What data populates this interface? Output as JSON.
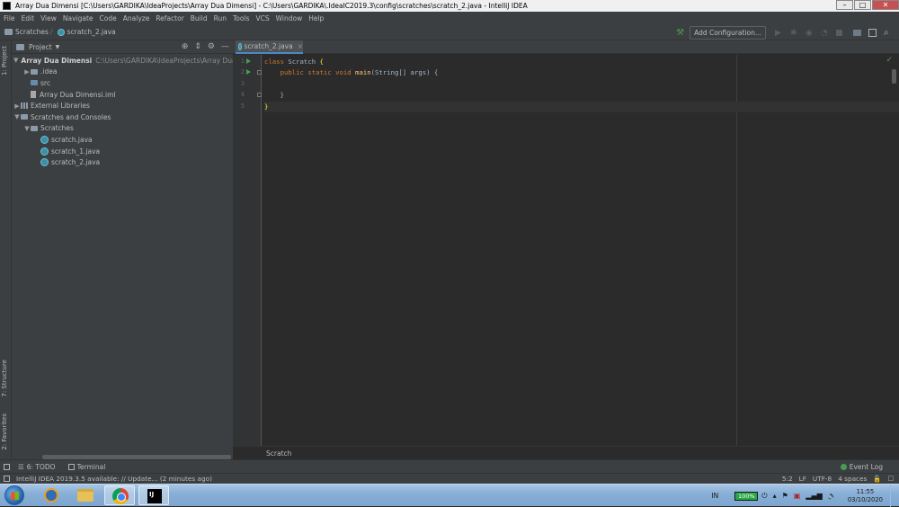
{
  "window": {
    "title": "Array Dua Dimensi [C:\\Users\\GARDIKA\\IdeaProjects\\Array Dua Dimensi] - C:\\Users\\GARDIKA\\.IdeaIC2019.3\\config\\scratches\\scratch_2.java - IntelliJ IDEA",
    "controls": [
      "–",
      "□",
      "✕"
    ]
  },
  "menu": [
    "File",
    "Edit",
    "View",
    "Navigate",
    "Code",
    "Analyze",
    "Refactor",
    "Build",
    "Run",
    "Tools",
    "VCS",
    "Window",
    "Help"
  ],
  "navbar": {
    "crumbs": [
      "Scratches",
      "scratch_2.java"
    ],
    "add_config": "Add Configuration..."
  },
  "left_strip": {
    "project_tab": "1: Project",
    "structure_tab": "7: Structure",
    "favorites_tab": "2: Favorites"
  },
  "project_panel": {
    "header": "Project",
    "tree": [
      {
        "label": "Array Dua Dimensi",
        "path": "C:\\Users\\GARDIKA\\IdeaProjects\\Array Dua Dimensi",
        "indent": 0,
        "arrow": "▼",
        "icon": "folder",
        "bold": true
      },
      {
        "label": ".idea",
        "indent": 1,
        "arrow": "▶",
        "icon": "folder"
      },
      {
        "label": "src",
        "indent": 1,
        "arrow": "",
        "icon": "src"
      },
      {
        "label": "Array Dua Dimensi.iml",
        "indent": 1,
        "arrow": "",
        "icon": "iml"
      },
      {
        "label": "External Libraries",
        "indent": 0,
        "arrow": "▶",
        "icon": "lib"
      },
      {
        "label": "Scratches and Consoles",
        "indent": 0,
        "arrow": "▼",
        "icon": "folder"
      },
      {
        "label": "Scratches",
        "indent": 1,
        "arrow": "▼",
        "icon": "folder"
      },
      {
        "label": "scratch.java",
        "indent": 2,
        "arrow": "",
        "icon": "java"
      },
      {
        "label": "scratch_1.java",
        "indent": 2,
        "arrow": "",
        "icon": "java"
      },
      {
        "label": "scratch_2.java",
        "indent": 2,
        "arrow": "",
        "icon": "java"
      }
    ]
  },
  "editor": {
    "tab": "scratch_2.java",
    "line_numbers": [
      "1",
      "2",
      "3",
      "4",
      "5"
    ],
    "lines": [
      [
        {
          "t": "class ",
          "c": "kw"
        },
        {
          "t": "Scratch ",
          "c": "tx"
        },
        {
          "t": "{",
          "c": "br"
        }
      ],
      [
        {
          "t": "    public static void ",
          "c": "kw"
        },
        {
          "t": "main",
          "c": "fn"
        },
        {
          "t": "(String[] args) {",
          "c": "tx"
        }
      ],
      [],
      [
        {
          "t": "    }",
          "c": "tx"
        }
      ],
      [
        {
          "t": "}",
          "c": "br"
        }
      ]
    ],
    "breadcrumb": "Scratch"
  },
  "tool_windows": {
    "todo": "6: TODO",
    "terminal": "Terminal",
    "event_log": "Event Log"
  },
  "status": {
    "message": "IntelliJ IDEA 2019.3.5 available: // Update... (2 minutes ago)",
    "position": "5:2",
    "line_sep": "LF",
    "encoding": "UTF-8",
    "indent": "4 spaces"
  },
  "taskbar": {
    "lang": "IN",
    "battery": "100%",
    "time": "11:55",
    "date": "03/10/2020"
  }
}
